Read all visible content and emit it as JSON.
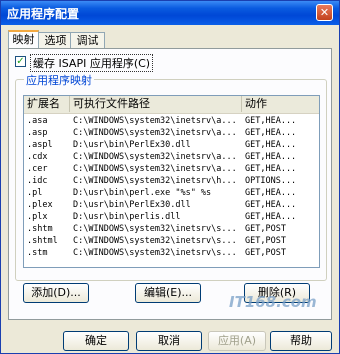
{
  "window": {
    "title": "应用程序配置",
    "close_glyph": "✕"
  },
  "tabs": [
    {
      "label": "映射"
    },
    {
      "label": "选项"
    },
    {
      "label": "调试"
    }
  ],
  "cache_isapi": {
    "label": "缓存 ISAPI 应用程序(C)",
    "checked_glyph": "✓"
  },
  "mappings": {
    "group_label": "应用程序映射",
    "columns": [
      "扩展名",
      "可执行文件路径",
      "动作"
    ],
    "rows": [
      [
        ".asa",
        "C:\\WINDOWS\\system32\\inetsrv\\a...",
        "GET,HEA..."
      ],
      [
        ".asp",
        "C:\\WINDOWS\\system32\\inetsrv\\a...",
        "GET,HEA..."
      ],
      [
        ".aspl",
        "D:\\usr\\bin\\PerlEx30.dll",
        "GET,HEA..."
      ],
      [
        ".cdx",
        "C:\\WINDOWS\\system32\\inetsrv\\a...",
        "GET,HEA..."
      ],
      [
        ".cer",
        "C:\\WINDOWS\\system32\\inetsrv\\a...",
        "GET,HEA..."
      ],
      [
        ".idc",
        "C:\\WINDOWS\\system32\\inetsrv\\h...",
        "OPTIONS..."
      ],
      [
        ".pl",
        "D:\\usr\\bin\\perl.exe \"%s\" %s",
        "GET,HEA..."
      ],
      [
        ".plex",
        "D:\\usr\\bin\\PerlEx30.dll",
        "GET,HEA..."
      ],
      [
        ".plx",
        "D:\\usr\\bin\\perlis.dll",
        "GET,HEA..."
      ],
      [
        ".shtm",
        "C:\\WINDOWS\\system32\\inetsrv\\s...",
        "GET,POST"
      ],
      [
        ".shtml",
        "C:\\WINDOWS\\system32\\inetsrv\\s...",
        "GET,POST"
      ],
      [
        ".stm",
        "C:\\WINDOWS\\system32\\inetsrv\\s...",
        "GET,POST"
      ]
    ]
  },
  "actions": {
    "add": "添加(D)...",
    "edit": "编辑(E)...",
    "remove": "删除(R)"
  },
  "footer": {
    "ok": "确定",
    "cancel": "取消",
    "apply": "应用(A)",
    "help": "帮助"
  },
  "watermark": "IT168.com"
}
